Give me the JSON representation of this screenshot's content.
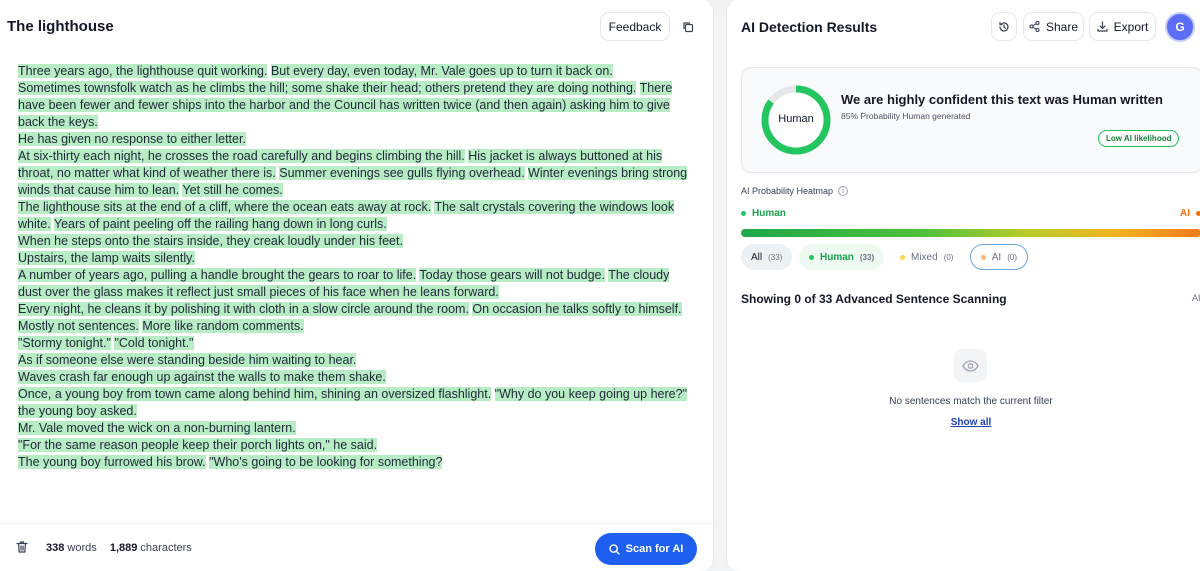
{
  "editor": {
    "title": "The lighthouse",
    "feedback_label": "Feedback",
    "paragraphs": [
      [
        "Three years ago, the lighthouse quit working.",
        "But every day, even today, Mr. Vale goes up to turn it back on."
      ],
      [
        "Sometimes townsfolk watch as he climbs the hill; some shake their head; others pretend they are doing nothing.",
        "There have been fewer and fewer ships into the harbor and the Council has written twice (and then again) asking him to give back the keys."
      ],
      [
        "He has given no response to either letter."
      ],
      [
        "At six-thirty each night, he crosses the road carefully and begins climbing the hill.",
        "His jacket is always buttoned at his throat, no matter what kind of weather there is.",
        "Summer evenings see gulls flying overhead.",
        "Winter evenings bring strong winds that cause him to lean.",
        "Yet still he comes."
      ],
      [
        "The lighthouse sits at the end of a cliff, where the ocean eats away at rock.",
        "The salt crystals covering the windows look white.",
        "Years of paint peeling off the railing hang down in long curls."
      ],
      [
        "When he steps onto the stairs inside, they creak loudly under his feet."
      ],
      [
        "Upstairs, the lamp waits silently."
      ],
      [
        "A number of years ago, pulling a handle brought the gears to roar to life.",
        "Today those gears will not budge.",
        "The cloudy dust over the glass makes it reflect just small pieces of his face when he leans forward."
      ],
      [
        "Every night, he cleans it by polishing it with cloth in a slow circle around the room.",
        "On occasion he talks softly to himself."
      ],
      [
        "Mostly not sentences.",
        "More like random comments."
      ],
      [
        "\"Stormy tonight.\"",
        "\"Cold tonight.\""
      ],
      [
        "As if someone else were standing beside him waiting to hear."
      ],
      [
        "Waves crash far enough up against the walls to make them shake."
      ],
      [
        "Once, a young boy from town came along behind him, shining an oversized flashlight.",
        "\"Why do you keep going up here?\" the young boy asked."
      ],
      [
        "Mr. Vale moved the wick on a non-burning lantern."
      ],
      [
        "\"For the same reason people keep their porch lights on,\" he said."
      ],
      [
        "The young boy furrowed his brow.",
        "\"Who's going to be looking for something?"
      ]
    ],
    "footer": {
      "word_count": "338",
      "word_label": "words",
      "char_count": "1,889",
      "char_label": "characters",
      "scan_label": "Scan for AI"
    }
  },
  "results": {
    "title": "AI Detection Results",
    "share_label": "Share",
    "export_label": "Export",
    "avatar_initial": "G",
    "verdict": "Human",
    "human_probability": 0.85,
    "confidence_title": "We are highly confident this text was Human written",
    "confidence_sub": "85% Probability Human generated",
    "likelihood_badge": "Low AI likelihood",
    "heatmap_title": "AI Probability Heatmap",
    "legend_human": "Human",
    "legend_ai": "AI",
    "filters": [
      {
        "label": "All",
        "count": "(33)"
      },
      {
        "label": "Human",
        "count": "(33)"
      },
      {
        "label": "Mixed",
        "count": "(0)"
      },
      {
        "label": "AI",
        "count": "(0)"
      }
    ],
    "showing_text": "Showing 0 of 33 Advanced Sentence Scanning",
    "showing_ai": "AI",
    "empty_message": "No sentences match the current filter",
    "show_all_label": "Show all"
  },
  "colors": {
    "human_green": "#22c55e",
    "ai_orange": "#f97316",
    "primary_blue": "#1f5ff0",
    "highlight_green": "#b7ecc5"
  }
}
